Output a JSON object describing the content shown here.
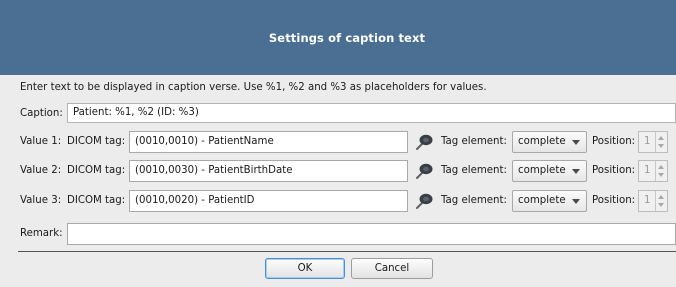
{
  "dialog": {
    "title": "Settings of caption text",
    "instruction": "Enter text to be displayed in caption verse. Use %1, %2 and %3 as placeholders for values.",
    "caption_label": "Caption:",
    "caption_value": "Patient: %1, %2 (ID: %3)",
    "remark_label": "Remark:",
    "remark_value": ""
  },
  "values": [
    {
      "label": "Value 1:",
      "tag_label": "DICOM tag:",
      "tag_value": "(0010,0010) - PatientName",
      "picker_icon": "color-picker-icon",
      "element_label": "Tag element:",
      "element_value": "complete",
      "position_label": "Position:",
      "position_value": "1"
    },
    {
      "label": "Value 2:",
      "tag_label": "DICOM tag:",
      "tag_value": "(0010,0030) - PatientBirthDate",
      "picker_icon": "color-picker-icon",
      "element_label": "Tag element:",
      "element_value": "complete",
      "position_label": "Position:",
      "position_value": "1"
    },
    {
      "label": "Value 3:",
      "tag_label": "DICOM tag:",
      "tag_value": "(0010,0020) - PatientID",
      "picker_icon": "color-picker-icon",
      "element_label": "Tag element:",
      "element_value": "complete",
      "position_label": "Position:",
      "position_value": "1"
    }
  ],
  "buttons": {
    "ok": "OK",
    "cancel": "Cancel"
  },
  "colors": {
    "titlebar": "#4a6f93",
    "background": "#ececec",
    "default_button_border": "#4a8fd6"
  }
}
